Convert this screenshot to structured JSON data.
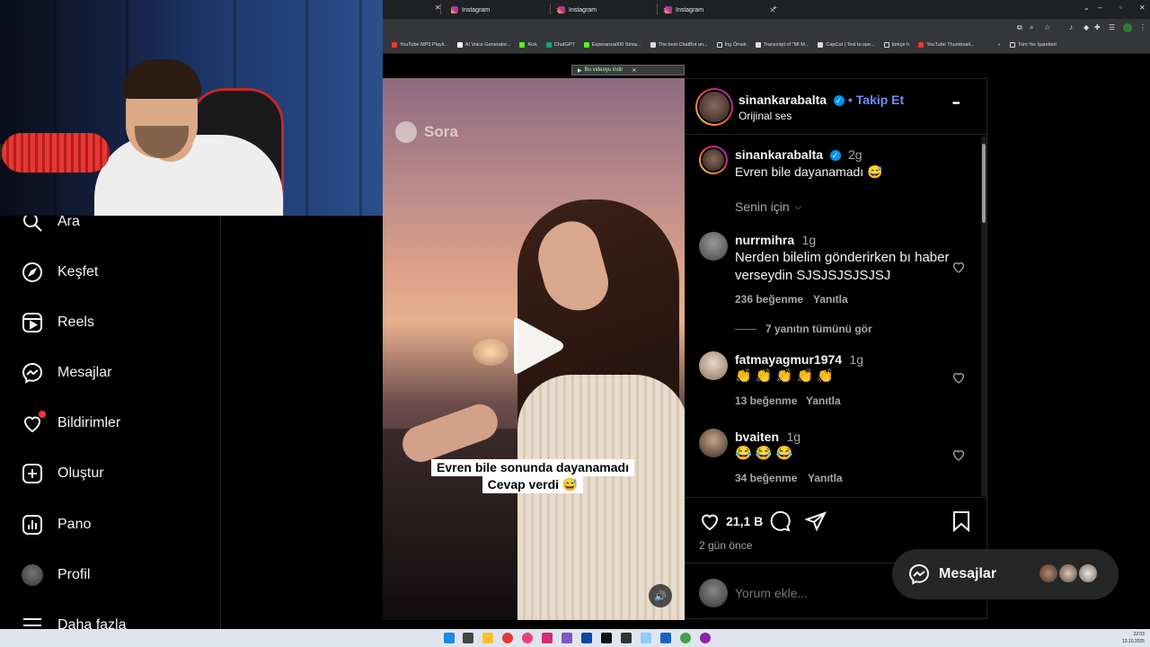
{
  "browser": {
    "tabs": [
      {
        "title": "Instagram"
      },
      {
        "title": "Instagram"
      },
      {
        "title": "Instagram"
      }
    ],
    "new_tab_symbol": "+",
    "bookmarks": [
      "YouTube MP3 Playli...",
      "AI Voice Generator...",
      "Kick",
      "ChatGPT",
      "Esperanza000 Strea...",
      "The best ChatBot an...",
      "İng Örnek",
      "Transcript of \"MI M...",
      "CapCut | Text to spe...",
      "türkçe h",
      "YouTube Thumbnail..."
    ],
    "bookmarks_more": "»",
    "all_bookmarks": "Tüm Yer İşaretleri",
    "download_banner": "Bu videoyu indir"
  },
  "sidebar": {
    "items": [
      {
        "label": "Ara",
        "icon": "search-icon"
      },
      {
        "label": "Keşfet",
        "icon": "compass-icon"
      },
      {
        "label": "Reels",
        "icon": "reels-icon"
      },
      {
        "label": "Mesajlar",
        "icon": "messenger-icon"
      },
      {
        "label": "Bildirimler",
        "icon": "heart-icon"
      },
      {
        "label": "Oluştur",
        "icon": "plus-square-icon"
      },
      {
        "label": "Pano",
        "icon": "dashboard-icon"
      },
      {
        "label": "Profil",
        "icon": "avatar-icon"
      },
      {
        "label": "Daha fazla",
        "icon": "menu-icon"
      }
    ]
  },
  "video": {
    "watermark": "Sora",
    "caption_line1": "Evren bile sonunda dayanamadı",
    "caption_line2": "Cevap verdi 😅"
  },
  "post": {
    "author": "sinankarabalta",
    "follow_label": "Takip Et",
    "audio": "Orijinal ses",
    "more_symbol": "•••",
    "caption": {
      "username": "sinankarabalta",
      "time": "2g",
      "text": "Evren bile dayanamadı 😅"
    },
    "filter_label": "Senin için",
    "comments": [
      {
        "username": "nurrmihra",
        "time": "1g",
        "text": "Nerden bilelim gönderirken bı haber verseydin SJSJSJSJSJSJ",
        "likes": "236 beğenme",
        "reply_label": "Yanıtla",
        "view_replies": "7 yanıtın tümünü gör"
      },
      {
        "username": "fatmayagmur1974",
        "time": "1g",
        "text": "👏 👏 👏 👏 👏",
        "likes": "13 beğenme",
        "reply_label": "Yanıtla"
      },
      {
        "username": "bvaiten",
        "time": "1g",
        "text": "😂 😂 😂",
        "likes": "34 beğenme",
        "reply_label": "Yanıtla"
      }
    ],
    "like_count": "21,1 B",
    "posted_ago": "2 gün önce",
    "comment_placeholder": "Yorum ekle..."
  },
  "messages_pill": {
    "label": "Mesajlar"
  },
  "taskbar": {
    "clock_time": "22:03",
    "clock_date": "13.10.2025"
  },
  "colors": {
    "follow": "#6e8cf7",
    "verified": "#0095f6",
    "notification_dot": "#ff3040"
  }
}
